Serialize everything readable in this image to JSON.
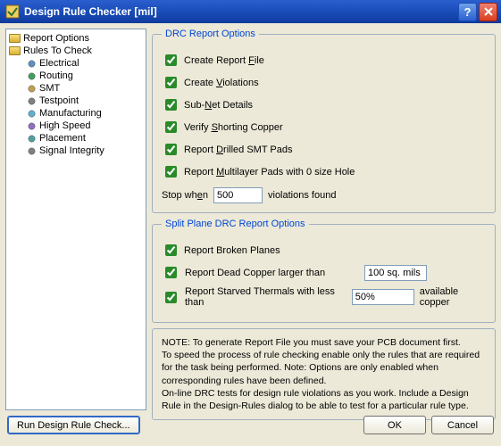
{
  "title": "Design Rule Checker [mil]",
  "tree": {
    "roots": [
      {
        "label": "Report Options"
      },
      {
        "label": "Rules To Check"
      }
    ],
    "children": [
      {
        "label": "Electrical",
        "color": "#6090c0"
      },
      {
        "label": "Routing",
        "color": "#40a060"
      },
      {
        "label": "SMT",
        "color": "#c0a050"
      },
      {
        "label": "Testpoint",
        "color": "#808080"
      },
      {
        "label": "Manufacturing",
        "color": "#60b0d0"
      },
      {
        "label": "High Speed",
        "color": "#9070c0"
      },
      {
        "label": "Placement",
        "color": "#50a0a0"
      },
      {
        "label": "Signal Integrity",
        "color": "#808080"
      }
    ]
  },
  "drc": {
    "legend": "DRC Report Options",
    "items": [
      {
        "html": "Create Report <u>F</u>ile"
      },
      {
        "html": "Create <u>V</u>iolations"
      },
      {
        "html": "Sub-<u>N</u>et Details"
      },
      {
        "html": "Verify <u>S</u>horting Copper"
      },
      {
        "html": "Report <u>D</u>rilled SMT Pads"
      },
      {
        "html": "Report <u>M</u>ultilayer Pads with 0 size Hole"
      }
    ],
    "stop_prefix": "Stop wh",
    "stop_underline": "e",
    "stop_suffix": "n",
    "stop_value": "500",
    "stop_after": "violations found"
  },
  "split": {
    "legend": "Split Plane DRC Report Options",
    "broken": "Report Broken Planes",
    "dead_label": "Report Dead Copper larger than",
    "dead_value": "100 sq. mils",
    "starved_label": "Report Starved Thermals with less than",
    "starved_value": "50%",
    "starved_after": "available copper"
  },
  "note": {
    "l1": "NOTE: To generate Report File you must save your PCB document first.",
    "l2": "To speed the process of rule checking enable only the rules that are required for the task being performed.  Note: Options are only enabled when corresponding rules have been defined.",
    "l3": "On-line DRC tests for design rule violations as you work. Include a Design Rule in the Design-Rules dialog to be able to test for a particular rule  type."
  },
  "buttons": {
    "run": "Run Design Rule Check...",
    "ok": "OK",
    "cancel": "Cancel"
  }
}
